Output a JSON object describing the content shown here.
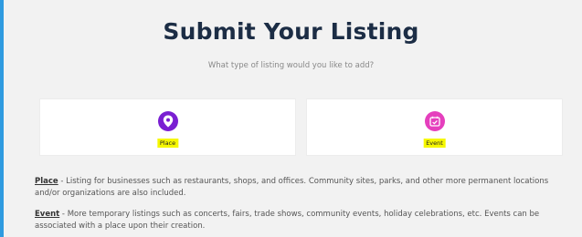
{
  "page": {
    "title": "Submit Your Listing",
    "subtitle": "What type of listing would you like to add?"
  },
  "options": [
    {
      "label": "Place",
      "icon": "map-pin-icon",
      "color": "#7a1fd2"
    },
    {
      "label": "Event",
      "icon": "calendar-check-icon",
      "color": "#e53fbd"
    }
  ],
  "descriptions": [
    {
      "term": "Place",
      "text": " - Listing for businesses such as restaurants, shops, and offices. Community sites, parks, and other more permanent locations and/or organizations are also included."
    },
    {
      "term": "Event",
      "text": " - More temporary listings such as concerts, fairs, trade shows, community events, holiday celebrations, etc. Events can be associated with a place upon their creation."
    }
  ],
  "colors": {
    "title": "#1c2d45",
    "highlight": "#f5f700",
    "accent": "#2f9be0"
  }
}
